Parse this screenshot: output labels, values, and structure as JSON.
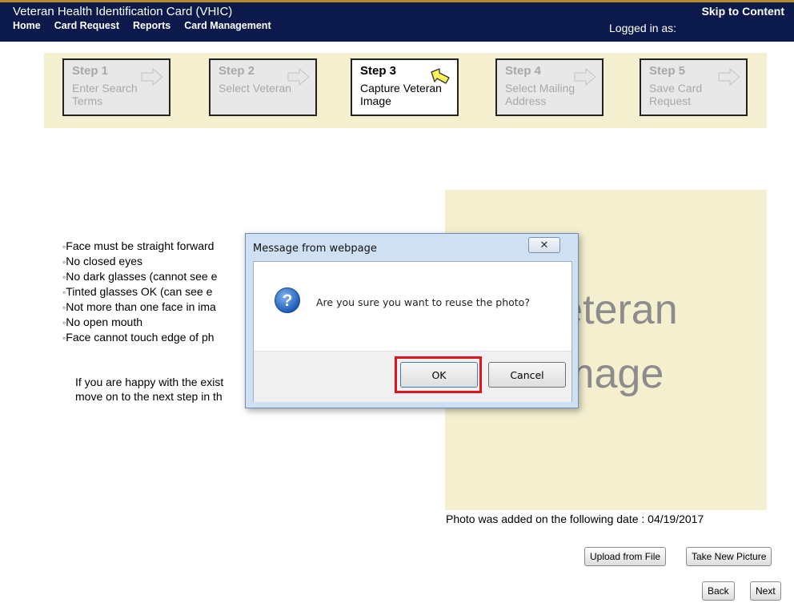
{
  "header": {
    "title": "Veteran Health Identification Card (VHIC)",
    "nav": [
      "Home",
      "Card Request",
      "Reports",
      "Card Management"
    ],
    "skip_link": "Skip to Content",
    "logged_in": "Logged in as:"
  },
  "steps": [
    {
      "num": "Step 1",
      "desc": "Enter Search Terms",
      "active": false
    },
    {
      "num": "Step 2",
      "desc": "Select Veteran",
      "active": false
    },
    {
      "num": "Step 3",
      "desc": "Capture Veteran Image",
      "active": true
    },
    {
      "num": "Step 4",
      "desc": "Select Mailing Address",
      "active": false
    },
    {
      "num": "Step 5",
      "desc": "Save Card Request",
      "active": false
    }
  ],
  "rules": [
    "Face must be straight forward",
    "No closed eyes",
    "No dark glasses (cannot see e",
    "Tinted glasses OK (can see e",
    "Not more than one face in ima",
    "No open mouth",
    "Face cannot touch edge of ph"
  ],
  "info_text": "If you are happy with the exist move on to the next step in th",
  "photo": {
    "placeholder_line1": "Veteran",
    "placeholder_line2": "Image",
    "date_text": "Photo was added on the following date : 04/19/2017"
  },
  "buttons": {
    "upload": "Upload from File",
    "take_picture": "Take New Picture",
    "back": "Back",
    "next": "Next"
  },
  "dialog": {
    "title": "Message from webpage",
    "message": "Are you sure you want to reuse the photo?",
    "ok": "OK",
    "cancel": "Cancel"
  },
  "colors": {
    "header_bg": "#0b1a4a",
    "panel_bg": "#f4efcf",
    "highlight": "#e0141e"
  }
}
